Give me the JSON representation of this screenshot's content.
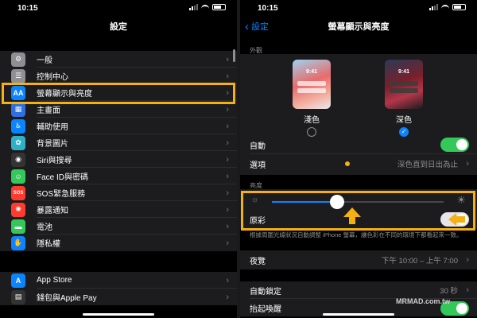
{
  "left": {
    "time": "10:15",
    "title": "設定",
    "items": [
      {
        "label": "一般",
        "icon": "gear-icon",
        "color": "#8e8e93",
        "glyph": "⚙"
      },
      {
        "label": "控制中心",
        "icon": "switches-icon",
        "color": "#8e8e93",
        "glyph": "☰"
      },
      {
        "label": "螢幕顯示與亮度",
        "icon": "display-aa-icon",
        "color": "#0a84ff",
        "glyph": "AA"
      },
      {
        "label": "主畫面",
        "icon": "home-grid-icon",
        "color": "#2f6fe0",
        "glyph": "▦"
      },
      {
        "label": "輔助使用",
        "icon": "accessibility-icon",
        "color": "#0a84ff",
        "glyph": "♿"
      },
      {
        "label": "背景圖片",
        "icon": "wallpaper-icon",
        "color": "#30b0c7",
        "glyph": "✿"
      },
      {
        "label": "Siri與搜尋",
        "icon": "siri-icon",
        "color": "#333333",
        "glyph": "◉"
      },
      {
        "label": "Face ID與密碼",
        "icon": "faceid-icon",
        "color": "#34c759",
        "glyph": "☺"
      },
      {
        "label": "SOS緊急服務",
        "icon": "sos-icon",
        "color": "#ff3b30",
        "glyph": "SOS"
      },
      {
        "label": "暴露通知",
        "icon": "exposure-icon",
        "color": "#ff3b30",
        "glyph": "✺"
      },
      {
        "label": "電池",
        "icon": "battery-icon",
        "color": "#34c759",
        "glyph": "▬"
      },
      {
        "label": "隱私權",
        "icon": "hand-icon",
        "color": "#0a84ff",
        "glyph": "✋"
      }
    ],
    "items2": [
      {
        "label": "App Store",
        "icon": "appstore-icon",
        "color": "#0a84ff",
        "glyph": "A"
      },
      {
        "label": "錢包與Apple Pay",
        "icon": "wallet-icon",
        "color": "#333333",
        "glyph": "▤"
      }
    ]
  },
  "right": {
    "time": "10:15",
    "back": "設定",
    "title": "螢幕顯示與亮度",
    "appearance_header": "外觀",
    "light_time": "9:41",
    "dark_time": "9:41",
    "light_label": "淺色",
    "dark_label": "深色",
    "auto_label": "自動",
    "options_label": "選項",
    "options_value": "深色直到日出為止",
    "brightness_header": "亮度",
    "brightness_level": 0.38,
    "truetone_label": "原彩",
    "truetone_desc": "根據周圍光線狀況自動調整 iPhone 螢幕，讓色彩在不同的環境下都看起來一致。",
    "nightshift_label": "夜覽",
    "nightshift_value": "下午 10:00 – 上午 7:00",
    "autolock_label": "自動鎖定",
    "autolock_value": "30 秒",
    "raise_label": "抬起喚醒",
    "watermark": "MRMAD.com.tw",
    "accent": "#f5b111"
  }
}
